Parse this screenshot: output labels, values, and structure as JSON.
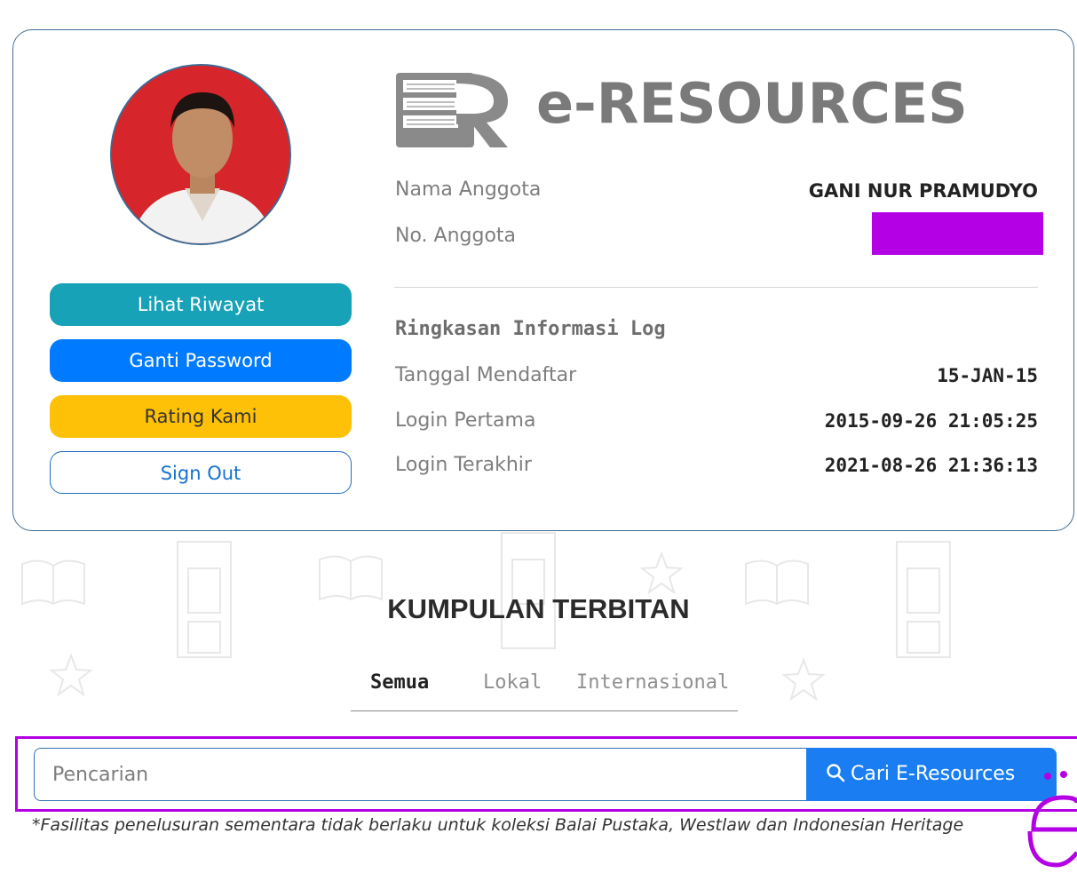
{
  "brand": {
    "name": "e-RESOURCES",
    "logo_icon": "er-logo-icon"
  },
  "member": {
    "name_label": "Nama Anggota",
    "name_value": "GANI NUR PRAMUDYO",
    "number_label": "No. Anggota"
  },
  "actions": {
    "history": "Lihat Riwayat",
    "password": "Ganti Password",
    "rating": "Rating Kami",
    "signout": "Sign Out"
  },
  "log": {
    "heading": "Ringkasan Informasi Log",
    "registered_label": "Tanggal Mendaftar",
    "registered_value": "15-JAN-15",
    "first_login_label": "Login Pertama",
    "first_login_value": "2015-09-26 21:05:25",
    "last_login_label": "Login Terakhir",
    "last_login_value": "2021-08-26 21:36:13"
  },
  "collection": {
    "title": "KUMPULAN TERBITAN",
    "tabs": [
      "Semua",
      "Lokal",
      "Internasional"
    ],
    "active_tab": "Semua"
  },
  "search": {
    "placeholder": "Pencarian",
    "button_label": "Cari E-Resources",
    "icon": "search-icon"
  },
  "footnote": "*Fasilitas penelusuran sementara tidak berlaku untuk koleksi Balai Pustaka, Westlaw dan Indonesian Heritage",
  "colors": {
    "history": "#17a2b8",
    "password": "#007bff",
    "rating": "#ffc107",
    "search_button": "#1a7ef2",
    "highlight": "#b400e4",
    "card_border": "#3f6e95"
  }
}
